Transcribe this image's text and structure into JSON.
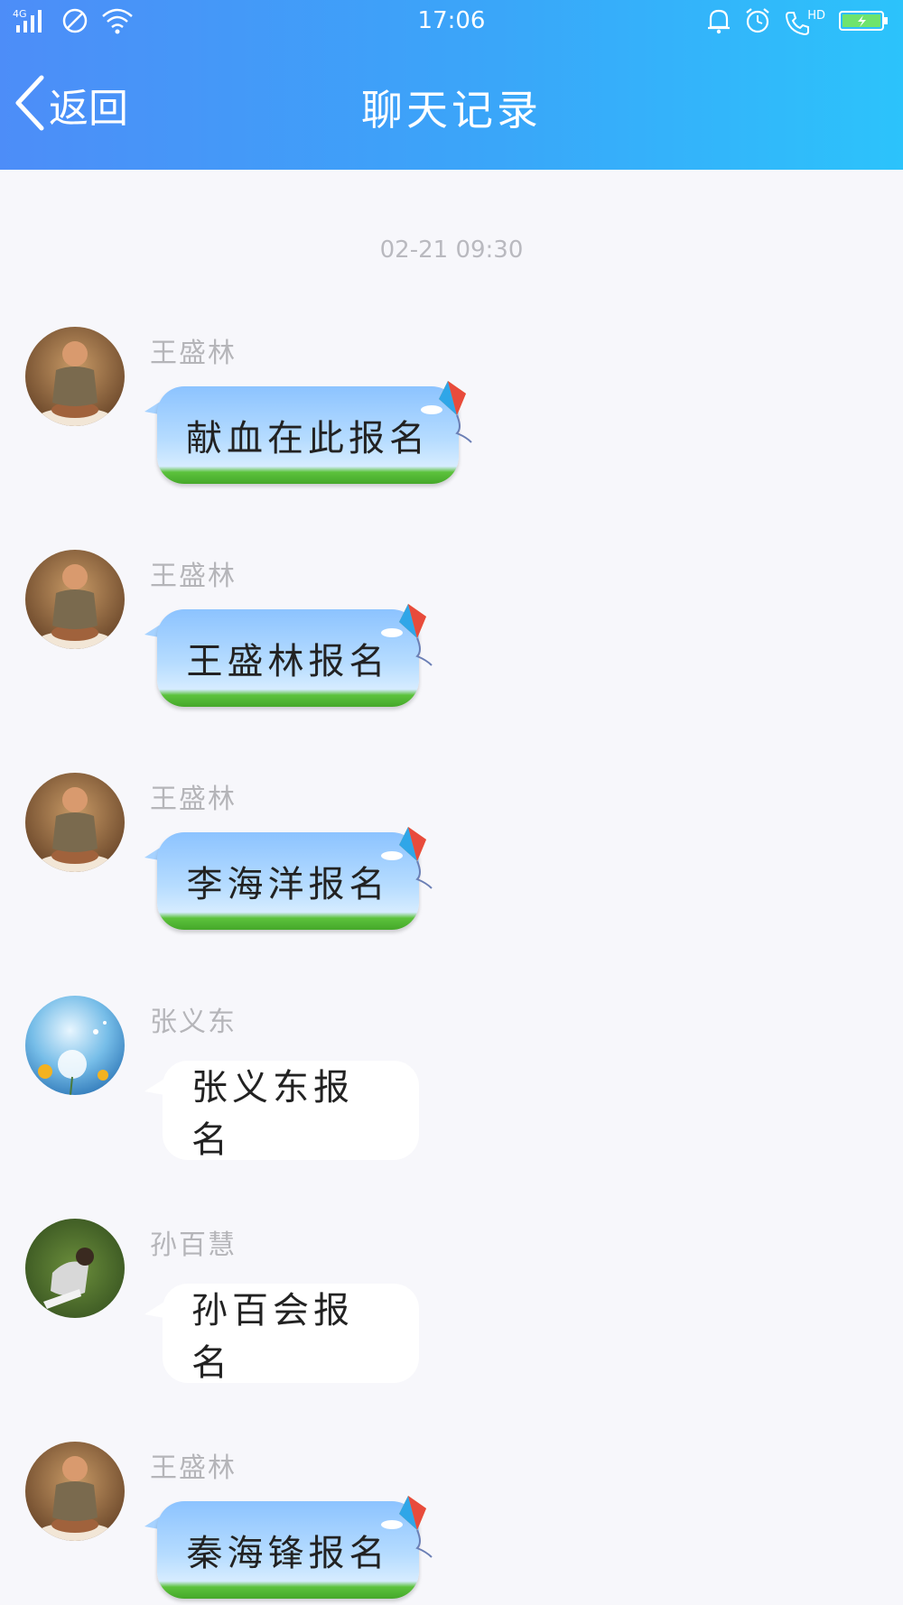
{
  "status_bar": {
    "time": "17:06",
    "network": "4G",
    "hd_label": "HD"
  },
  "header": {
    "back_label": "返回",
    "title": "聊天记录"
  },
  "timestamp": "02-21 09:30",
  "messages": [
    {
      "sender": "王盛林",
      "text": "献血在此报名",
      "bubble_style": "kite",
      "avatar": "monk-figurine"
    },
    {
      "sender": "王盛林",
      "text": "王盛林报名",
      "bubble_style": "kite",
      "avatar": "monk-figurine"
    },
    {
      "sender": "王盛林",
      "text": "李海洋报名",
      "bubble_style": "kite",
      "avatar": "monk-figurine"
    },
    {
      "sender": "张义东",
      "text": "张义东报名",
      "bubble_style": "plain",
      "avatar": "dandelion"
    },
    {
      "sender": "孙百慧",
      "text": "孙百会报名",
      "bubble_style": "plain",
      "avatar": "woman-on-grass"
    },
    {
      "sender": "王盛林",
      "text": "秦海锋报名",
      "bubble_style": "kite",
      "avatar": "monk-figurine"
    }
  ],
  "colors": {
    "header_start": "#4d8df8",
    "header_end": "#2cc3fb",
    "background": "#f7f7fb",
    "bubble_grass": "#45a82a",
    "bubble_sky": "#8cc3ff"
  }
}
